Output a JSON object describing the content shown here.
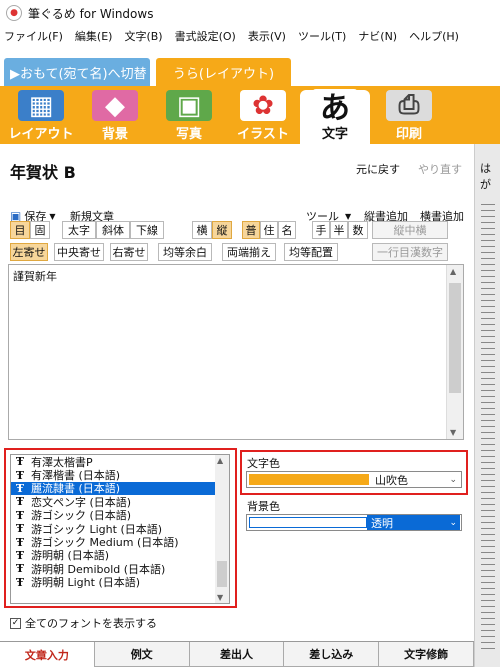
{
  "window": {
    "title": "筆ぐるめ for Windows",
    "icon": "app-icon"
  },
  "menu": [
    "ファイル(F)",
    "編集(E)",
    "文字(B)",
    "書式設定(O)",
    "表示(V)",
    "ツール(T)",
    "ナビ(N)",
    "ヘルプ(H)"
  ],
  "mode": {
    "front_label": "▶おもて(宛て名)へ切替",
    "back_label": "うら(レイアウト)"
  },
  "tools": [
    {
      "label": "レイアウト",
      "icon": "layout-icon",
      "glyph": "▦"
    },
    {
      "label": "背景",
      "icon": "background-icon",
      "glyph": "◆"
    },
    {
      "label": "写真",
      "icon": "photo-icon",
      "glyph": "▣"
    },
    {
      "label": "イラスト",
      "icon": "illustration-icon",
      "glyph": "✿"
    },
    {
      "label": "文字",
      "icon": "text-icon",
      "glyph": "あ"
    },
    {
      "label": "印刷",
      "icon": "printer-icon",
      "glyph": "⎙"
    }
  ],
  "active_tool": 4,
  "document": {
    "title": "年賀状 B",
    "undo": "元に戻す",
    "redo": "やり直す"
  },
  "ruler_label": "はが",
  "toolbar2": {
    "save": "保存",
    "new_text": "新規文章",
    "tools": "ツール",
    "vertical_add": "縦書追加",
    "horizontal_add": "横書追加"
  },
  "format_row1": {
    "mincho": "目",
    "gothic": "固",
    "bold": "太字",
    "italic": "斜体",
    "underline": "下線",
    "horizontal": "横",
    "vertical": "縦",
    "normal": "普",
    "address": "住",
    "name": "名",
    "hand": "手",
    "half": "半",
    "number": "数",
    "tate_chu_yoko": "縦中横"
  },
  "format_row2": {
    "left": "左寄せ",
    "center": "中央寄せ",
    "right": "右寄せ",
    "even_margin": "均等余白",
    "justify": "両端揃え",
    "even_place": "均等配置",
    "kanji_num": "一行目漢数字"
  },
  "text_content": "謹賀新年",
  "fonts": [
    "有澤太楷書P",
    "有澤楷書 (日本語)",
    "麗流隷書 (日本語)",
    "恋文ペン字 (日本語)",
    "游ゴシック (日本語)",
    "游ゴシック Light (日本語)",
    "游ゴシック Medium (日本語)",
    "游明朝 (日本語)",
    "游明朝 Demibold (日本語)",
    "游明朝 Light (日本語)"
  ],
  "selected_font": 2,
  "text_color": {
    "label": "文字色",
    "value": "山吹色",
    "hex": "#f6a918"
  },
  "bg_color": {
    "label": "背景色",
    "value": "透明",
    "hex": "#0a6ad6"
  },
  "show_all_fonts": {
    "label": "全てのフォントを表示する",
    "checked": true
  },
  "bottom_tabs": [
    "文章入力",
    "例文",
    "差出人",
    "差し込み",
    "文字修飾"
  ],
  "active_bottom_tab": 0,
  "colors": {
    "accent_orange": "#f6a918",
    "front_tab_blue": "#6aaee0",
    "highlight_red": "#e0201e"
  }
}
